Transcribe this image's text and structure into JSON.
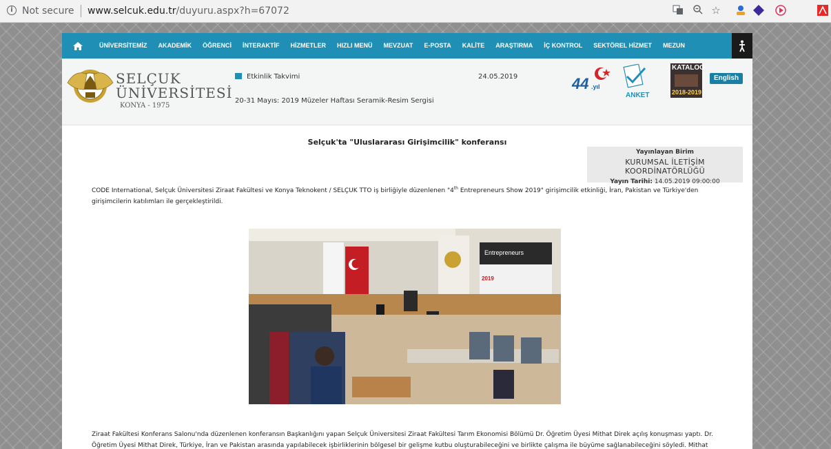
{
  "browser": {
    "security_label": "Not secure",
    "url_domain": "www.selcuk.edu.tr",
    "url_path": "/duyuru.aspx?h=67072"
  },
  "nav": {
    "items": [
      "ÜNİVERSİTEMİZ",
      "AKADEMİK",
      "ÖĞRENCİ",
      "İNTERAKTİF",
      "HİZMETLER",
      "HIZLI MENÜ",
      "MEVZUAT",
      "E-POSTA",
      "KALİTE",
      "ARAŞTIRMA",
      "İÇ KONTROL",
      "SEKTÖREL HİZMET",
      "MEZUN"
    ]
  },
  "header": {
    "logo_line1": "SELÇUK",
    "logo_line2": "ÜNİVERSİTESİ",
    "logo_line3": "KONYA - 1975",
    "event_label": "Etkinlik Takvimi",
    "event_date": "24.05.2019",
    "event_text": "20-31 Mayıs: 2019 Müzeler Haftası Seramik-Resim Sergisi",
    "anniversary": "44",
    "anniversary_suffix": ".yıl",
    "survey_label": "ANKET",
    "catalog_label": "KATALOG",
    "catalog_years": "2018-2019",
    "language_button": "English"
  },
  "article": {
    "title": "Selçuk'ta \"Uluslararası Girişimcilik\" konferansı",
    "publisher_heading": "Yayınlayan Birim",
    "publisher_name": "KURUMSAL İLETİŞİM KOORDİNATÖRLÜĞÜ",
    "publish_date_label": "Yayın Tarihi:",
    "publish_date_value": "14.05.2019 09:00:00",
    "paragraph1_a": "CODE International, Selçuk Üniversitesi Ziraat Fakültesi ve Konya Teknokent / SELÇUK TTO iş birliğiyle düzenlenen \"4",
    "paragraph1_sup": "th",
    "paragraph1_b": " Entrepreneurs Show 2019\" girişimcilik etkinliği, İran, Pakistan ve Türkiye'den",
    "paragraph1_line2": "girişimcilerin katılımları ile gerçekleştirildi.",
    "paragraph2_line1": "Ziraat Fakültesi Konferans Salonu'nda düzenlenen konferansın Başkanlığını yapan Selçuk Üniversitesi Ziraat Fakültesi Tarım Ekonomisi Bölümü Dr. Öğretim Üyesi Mithat Direk açılış konuşması yaptı. Dr.",
    "paragraph2_line2": "Öğretim Üyesi Mithat Direk, Türkiye, İran ve Pakistan arasında yapılabilecek işbirliklerinin bölgesel bir gelişme kutbu oluşturabileceğini ve birlikte çalışma ile büyüme sağlanabileceğini söyledi. Mithat",
    "photo_screen_text": "Entrepreneurs",
    "photo_screen_year": "2019"
  }
}
